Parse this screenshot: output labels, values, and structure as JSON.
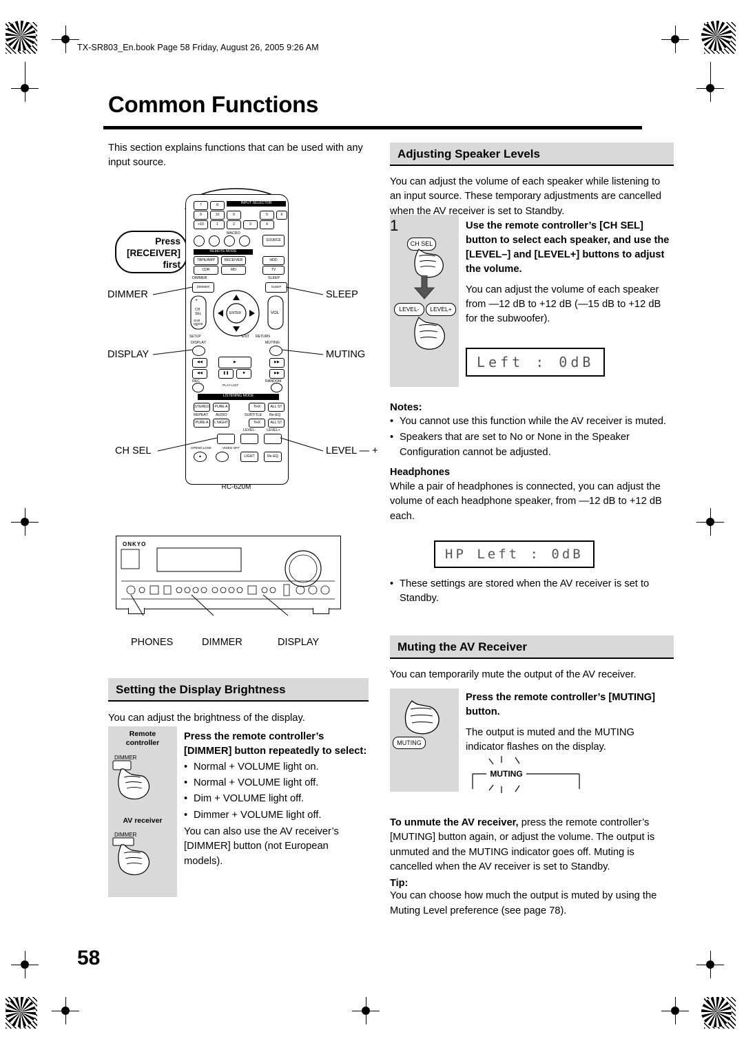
{
  "header": {
    "book_line": "TX-SR803_En.book  Page 58  Friday, August 26, 2005  9:26 AM"
  },
  "page": {
    "title": "Common Functions",
    "number": "58"
  },
  "intro": {
    "text": "This section explains functions that can be used with any input source."
  },
  "remote_illustration": {
    "press_bubble": [
      "Press",
      "[RECEIVER]",
      "first"
    ],
    "callouts": {
      "dimmer": "DIMMER",
      "sleep": "SLEEP",
      "display": "DISPLAY",
      "muting": "MUTING",
      "ch_sel": "CH SEL",
      "level": "LEVEL — +"
    },
    "model": "RC-620M",
    "keys": {
      "row_num": [
        "7",
        "8",
        "9",
        "10",
        "0",
        "+10",
        "1",
        "2",
        "3",
        "4",
        "5",
        "6"
      ],
      "input_selector": "INPUT SELECTOR",
      "macro": "MACRO",
      "remote_mode": "REMOTE MODE",
      "tape_amp": "TAPE/AMP",
      "cdr": "CDR",
      "md": "MD",
      "dimmer_key": "DIMMER",
      "sleep_key": "SLEEP",
      "vol": "VOL",
      "enter": "ENTER",
      "ch_sel_key": "CH\nSEL",
      "sub_mode": "SUB\nMODE",
      "setup": "SETUP",
      "exit": "EXIT",
      "return": "RETURN",
      "display_key": "DISPLAY",
      "muting_key": "MUTING",
      "listening_mode": "LISTENING MODE",
      "repeat": "REPEAT",
      "audio": "AUDIO",
      "subtitle": "SUBTITLE",
      "random": "RANDOM",
      "play_list": "PLAY LIST",
      "level_minus": "LEVEL-",
      "level_plus": "LEVEL+",
      "open_close": "OPEN/CLOSE",
      "video_off": "VIDEO OFF",
      "light": "LIGHT",
      "rec": "REC",
      "stereo": "STEREO",
      "thx": "THX",
      "all_st": "ALL ST",
      "pure_a": "PURE A",
      "re_eq": "Re-EQ"
    }
  },
  "receiver_illustration": {
    "brand": "ONKYO",
    "callouts": [
      "PHONES",
      "DIMMER",
      "DISPLAY"
    ]
  },
  "display_brightness": {
    "heading": "Setting the Display Brightness",
    "intro": "You can adjust the brightness of the display.",
    "labels": {
      "remote_controller": [
        "Remote",
        "controller"
      ],
      "av_receiver": "AV receiver",
      "dimmer": "DIMMER"
    },
    "step_lead": "Press the remote controller’s [DIMMER] button repeatedly to select:",
    "options": [
      "Normal + VOLUME light on.",
      "Normal + VOLUME light off.",
      "Dim + VOLUME light off.",
      "Dimmer + VOLUME light off."
    ],
    "footnote": "You can also use the AV receiver’s [DIMMER] button (not European models)."
  },
  "speaker_levels": {
    "heading": "Adjusting Speaker Levels",
    "intro": "You can adjust the volume of each speaker while listening to an input source. These temporary adjustments are cancelled when the AV receiver is set to Standby.",
    "step_number": "1",
    "step_lead": "Use the remote controller’s [CH SEL] button to select each speaker, and use the [LEVEL–] and [LEVEL+] buttons to adjust the volume.",
    "step_body": "You can adjust the volume of each speaker from —12 dB to +12 dB (—15 dB to +12 dB for the subwoofer).",
    "button_labels": {
      "ch_sel": "CH SEL",
      "level_minus": "LEVEL-",
      "level_plus": "LEVEL+"
    },
    "lcd_1": "Left          :      0dB",
    "notes_heading": "Notes:",
    "notes": [
      "You cannot use this function while the AV receiver is muted.",
      "Speakers that are set to No or None in the Speaker Configuration cannot be adjusted."
    ],
    "headphones_heading": "Headphones",
    "headphones_text": "While a pair of headphones is connected, you can adjust the volume of each headphone speaker, from —12 dB to +12 dB each.",
    "lcd_2": "HP Left  :  0dB",
    "final_note": "These settings are stored when the AV receiver is set to Standby."
  },
  "muting": {
    "heading": "Muting the AV Receiver",
    "intro": "You can temporarily mute the output of the AV receiver.",
    "step_lead": "Press the remote controller’s [MUTING] button.",
    "step_body": "The output is muted and the MUTING indicator flashes on the display.",
    "button_label": "MUTING",
    "indicator_label": "MUTING",
    "unmute_bold": "To unmute the AV receiver,",
    "unmute_text": " press the remote controller’s [MUTING] button again, or adjust the volume. The output is unmuted and the MUTING indicator goes off. Muting is cancelled when the AV receiver is set to Standby.",
    "tip_heading": "Tip:",
    "tip_text": "You can choose how much the output is muted by using the Muting Level preference (see page 78)."
  }
}
